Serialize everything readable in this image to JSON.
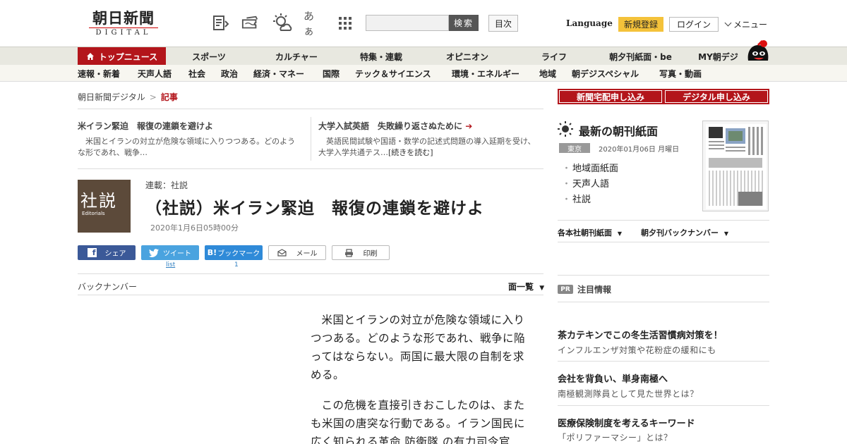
{
  "header": {
    "logo_main": "朝日新聞",
    "logo_sub": "DIGITAL",
    "search_placeholder": "",
    "search_button": "検索",
    "toc_button": "目次",
    "language": "Language",
    "signup": "新規登録",
    "login": "ログイン",
    "menu": "メニュー",
    "icons": [
      "news-list-icon",
      "ticket-icon",
      "weather-icon",
      "font-size-icon",
      "grid-icon"
    ],
    "font_size_glyph": "あぁ"
  },
  "nav_primary": [
    {
      "label": "トップニュース"
    },
    {
      "label": "スポーツ"
    },
    {
      "label": "カルチャー"
    },
    {
      "label": "特集・連載"
    },
    {
      "label": "オピニオン"
    },
    {
      "label": "ライフ"
    },
    {
      "label": "朝夕刊紙面・be"
    },
    {
      "label": "MY朝デジ"
    }
  ],
  "nav_secondary": [
    {
      "label": "速報・新着"
    },
    {
      "label": "天声人語"
    },
    {
      "label": "社会"
    },
    {
      "label": "政治"
    },
    {
      "label": "経済・マネー"
    },
    {
      "label": "国際"
    },
    {
      "label": "テック＆サイエンス"
    },
    {
      "label": "環境・エネルギー"
    },
    {
      "label": "地域"
    },
    {
      "label": "朝デジスペシャル"
    },
    {
      "label": "写真・動画"
    }
  ],
  "breadcrumb": {
    "root": "朝日新聞デジタル",
    "separator": ">",
    "current": "記事"
  },
  "related": [
    {
      "title": "米イラン緊迫　報復の連鎖を避けよ",
      "text": "米国とイランの対立が危険な領域に入りつつある。どのような形であれ、戦争…"
    },
    {
      "title": "大学入試英語　失敗繰り返さぬために",
      "text": "英語民間試験や国語・数学の記述式問題の導入延期を受け、大学入学共通テス…",
      "more": "[続きを読む]"
    }
  ],
  "article": {
    "series_image_big": "社説",
    "series_image_small": "Editorials",
    "series_label": "連載：社説",
    "title": "（社説）米イラン緊迫　報復の連鎖を避けよ",
    "date": "2020年1月6日05時00分",
    "share": {
      "facebook": "シェア",
      "twitter": "ツイート",
      "hatena_icon": "B!",
      "hatena": "ブックマーク",
      "mail": "メール",
      "print": "印刷",
      "twitter_count": "list",
      "hatena_count": "1"
    },
    "back_numbers": "バックナンバー",
    "list_all": "面一覧",
    "paragraphs": [
      "米国とイランの対立が危険な領域に入りつつある。どのような形であれ、戦争に陥ってはならない。両国に最大限の自制を求める。",
      "この危機を直接引きおこしたのは、またも米国の唐突な行動である。イラン国民に広く知られる革命 防衛隊 の有力司令官"
    ]
  },
  "sidebar": {
    "home_delivery": "新聞宅配申し込み",
    "digital_signup": "デジタル申し込み",
    "paper_heading": "最新の朝刊紙面",
    "region": "東京",
    "paper_date": "2020年01月06日 月曜日",
    "paper_links": [
      "地域面紙面",
      "天声人語",
      "社説"
    ],
    "dropdowns": [
      "各本社朝刊紙面",
      "朝夕刊バックナンバー"
    ],
    "pr_badge": "PR",
    "pr_heading": "注目情報",
    "ads": [
      {
        "title": "茶カテキンでこの冬生活習慣病対策を！",
        "sub": "インフルエンザ対策や花粉症の緩和にも"
      },
      {
        "title": "会社を背負い、単身南極へ",
        "sub": "南極観測隊員として見た世界とは？"
      },
      {
        "title": "医療保険制度を考えるキーワード",
        "sub": "「ポリファーマシー」とは？"
      }
    ]
  },
  "colors": {
    "brand_red": "#b3151b",
    "signup_yellow": "#f4c23a",
    "facebook": "#3b5998",
    "twitter": "#4aa3df",
    "hatena": "#2f8ad8"
  }
}
